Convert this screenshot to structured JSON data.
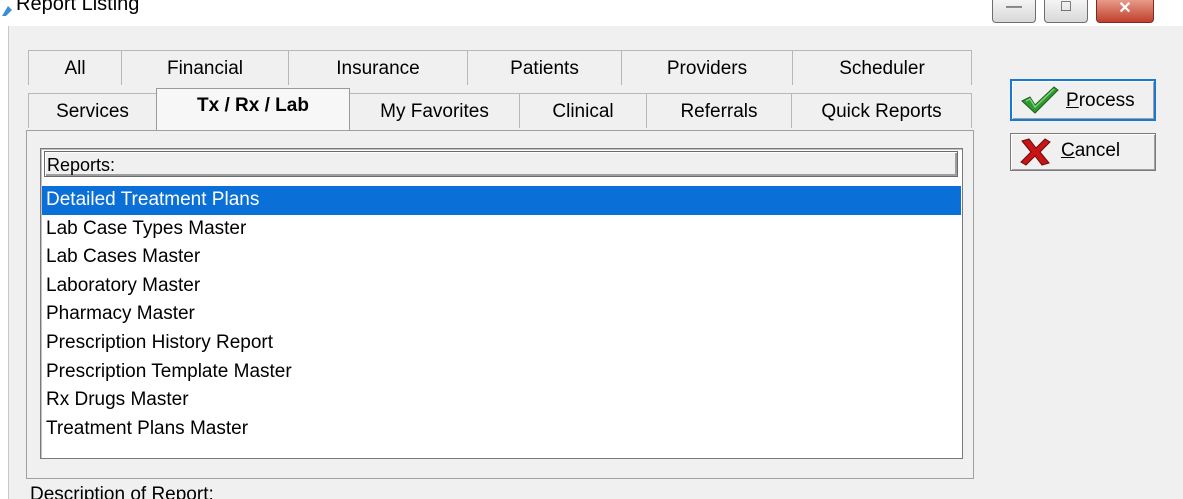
{
  "window": {
    "title": "Report Listing"
  },
  "tabs": {
    "row1": [
      {
        "id": "all",
        "label": "All"
      },
      {
        "id": "financial",
        "label": "Financial"
      },
      {
        "id": "insurance",
        "label": "Insurance"
      },
      {
        "id": "patients",
        "label": "Patients"
      },
      {
        "id": "providers",
        "label": "Providers"
      },
      {
        "id": "scheduler",
        "label": "Scheduler"
      }
    ],
    "row2": [
      {
        "id": "services",
        "label": "Services"
      },
      {
        "id": "tx-rx-lab",
        "label": "Tx / Rx / Lab",
        "active": true
      },
      {
        "id": "my-favorites",
        "label": "My Favorites"
      },
      {
        "id": "clinical",
        "label": "Clinical"
      },
      {
        "id": "referrals",
        "label": "Referrals"
      },
      {
        "id": "quick-reports",
        "label": "Quick Reports"
      }
    ]
  },
  "reports": {
    "header": "Reports:",
    "items": [
      {
        "label": "Detailed Treatment Plans",
        "selected": true
      },
      {
        "label": "Lab Case Types Master"
      },
      {
        "label": "Lab Cases Master"
      },
      {
        "label": "Laboratory Master"
      },
      {
        "label": "Pharmacy Master"
      },
      {
        "label": "Prescription History Report"
      },
      {
        "label": "Prescription Template Master"
      },
      {
        "label": "Rx Drugs Master"
      },
      {
        "label": "Treatment Plans Master"
      }
    ]
  },
  "buttons": {
    "process": {
      "label_hotkey": "P",
      "label_rest": "rocess",
      "icon": "check-icon"
    },
    "cancel": {
      "label_hotkey": "C",
      "label_rest": "ancel",
      "icon": "x-icon"
    }
  },
  "description": {
    "label": "Description of Report:"
  },
  "colors": {
    "selection": "#0a6fd6",
    "process_border": "#1a78d0",
    "check": "#2f9a2f",
    "cancel_x": "#c81414"
  }
}
